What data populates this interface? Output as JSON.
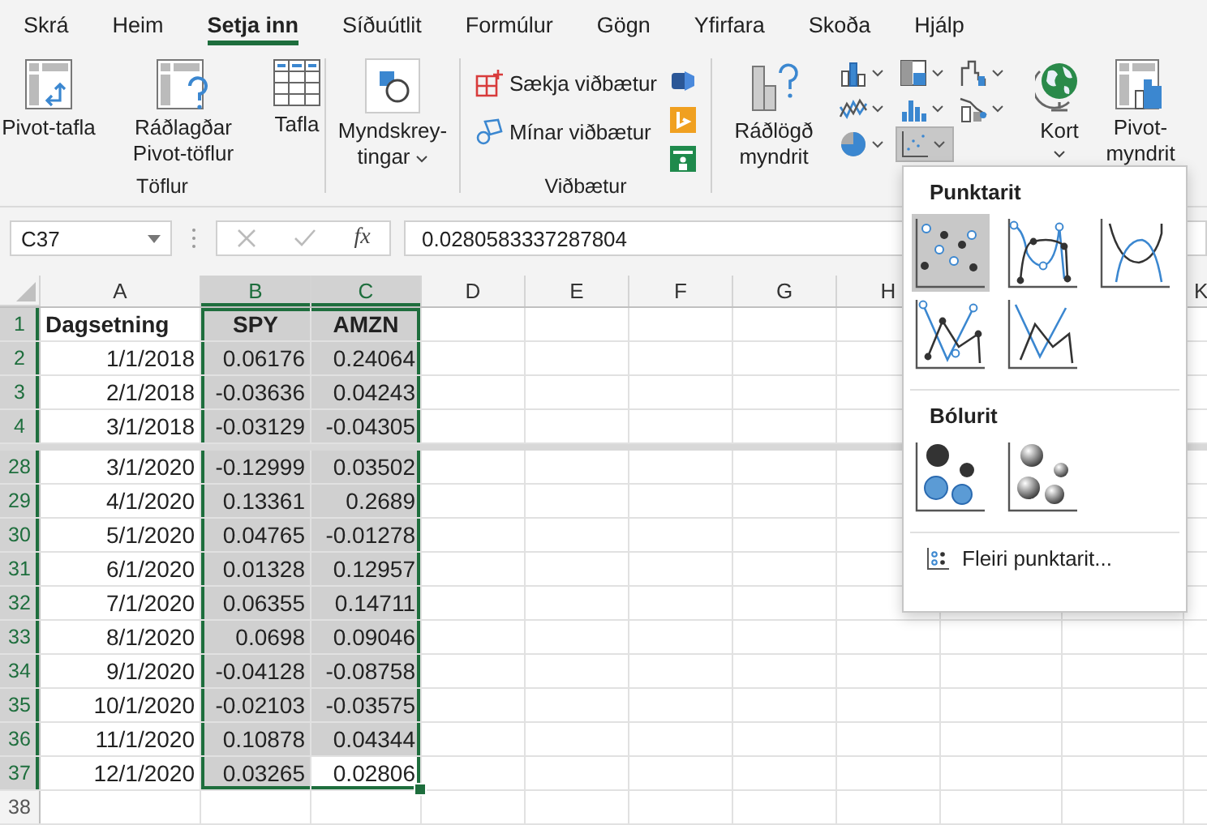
{
  "menu_tabs": [
    {
      "label": "Skrá",
      "selected": false
    },
    {
      "label": "Heim",
      "selected": false
    },
    {
      "label": "Setja inn",
      "selected": true
    },
    {
      "label": "Síðuútlit",
      "selected": false
    },
    {
      "label": "Formúlur",
      "selected": false
    },
    {
      "label": "Gögn",
      "selected": false
    },
    {
      "label": "Yfirfara",
      "selected": false
    },
    {
      "label": "Skoða",
      "selected": false
    },
    {
      "label": "Hjálp",
      "selected": false
    }
  ],
  "ribbon": {
    "tables": {
      "label": "Töflur",
      "buttons": [
        "Pivot-tafla",
        "Ráðlagðar\nPivot-töflur",
        "Tafla"
      ]
    },
    "illustrations": {
      "button": "Myndskrey-\ntingar"
    },
    "addins": {
      "label": "Viðbætur",
      "buttons": [
        "Sækja viðbætur",
        "Mínar viðbætur"
      ]
    },
    "charts": {
      "recommended": "Ráðlögð\nmyndrit",
      "maps": "Kort",
      "pivot_chart": "Pivot-\nmyndrit",
      "type_buttons": [
        {
          "selected": false
        },
        {
          "selected": false
        },
        {
          "selected": false
        },
        {
          "selected": false
        },
        {
          "selected": false
        },
        {
          "selected": false
        },
        {
          "selected": false
        },
        {
          "selected": true
        }
      ]
    }
  },
  "formula_bar": {
    "name_box": "C37",
    "function_label": "fx",
    "formula": "0.0280583337287804"
  },
  "sheet": {
    "columns": [
      {
        "label": "A",
        "selected": false
      },
      {
        "label": "B",
        "selected": true
      },
      {
        "label": "C",
        "selected": true
      },
      {
        "label": "D",
        "selected": false
      },
      {
        "label": "E",
        "selected": false
      },
      {
        "label": "F",
        "selected": false
      },
      {
        "label": "G",
        "selected": false
      },
      {
        "label": "H",
        "selected": false
      },
      {
        "label": "K",
        "selected": false
      }
    ],
    "rows": [
      {
        "number": "1",
        "kind": "header",
        "cells": [
          "Dagsetning",
          "SPY",
          "AMZN"
        ],
        "selected": true,
        "active": false,
        "break_after": false
      },
      {
        "number": "2",
        "kind": "data",
        "cells": [
          "1/1/2018",
          "0.06176",
          "0.24064"
        ],
        "selected": true,
        "active": false,
        "break_after": false
      },
      {
        "number": "3",
        "kind": "data",
        "cells": [
          "2/1/2018",
          "-0.03636",
          "0.04243"
        ],
        "selected": true,
        "active": false,
        "break_after": false
      },
      {
        "number": "4",
        "kind": "data",
        "cells": [
          "3/1/2018",
          "-0.03129",
          "-0.04305"
        ],
        "selected": true,
        "active": false,
        "break_after": true
      },
      {
        "number": "28",
        "kind": "data",
        "cells": [
          "3/1/2020",
          "-0.12999",
          "0.03502"
        ],
        "selected": true,
        "active": false,
        "break_after": false
      },
      {
        "number": "29",
        "kind": "data",
        "cells": [
          "4/1/2020",
          "0.13361",
          "0.2689"
        ],
        "selected": true,
        "active": false,
        "break_after": false
      },
      {
        "number": "30",
        "kind": "data",
        "cells": [
          "5/1/2020",
          "0.04765",
          "-0.01278"
        ],
        "selected": true,
        "active": false,
        "break_after": false
      },
      {
        "number": "31",
        "kind": "data",
        "cells": [
          "6/1/2020",
          "0.01328",
          "0.12957"
        ],
        "selected": true,
        "active": false,
        "break_after": false
      },
      {
        "number": "32",
        "kind": "data",
        "cells": [
          "7/1/2020",
          "0.06355",
          "0.14711"
        ],
        "selected": true,
        "active": false,
        "break_after": false
      },
      {
        "number": "33",
        "kind": "data",
        "cells": [
          "8/1/2020",
          "0.0698",
          "0.09046"
        ],
        "selected": true,
        "active": false,
        "break_after": false
      },
      {
        "number": "34",
        "kind": "data",
        "cells": [
          "9/1/2020",
          "-0.04128",
          "-0.08758"
        ],
        "selected": true,
        "active": false,
        "break_after": false
      },
      {
        "number": "35",
        "kind": "data",
        "cells": [
          "10/1/2020",
          "-0.02103",
          "-0.03575"
        ],
        "selected": true,
        "active": false,
        "break_after": false
      },
      {
        "number": "36",
        "kind": "data",
        "cells": [
          "11/1/2020",
          "0.10878",
          "0.04344"
        ],
        "selected": true,
        "active": false,
        "break_after": false
      },
      {
        "number": "37",
        "kind": "data",
        "cells": [
          "12/1/2020",
          "0.03265",
          "0.02806"
        ],
        "selected": true,
        "active": true,
        "break_after": false
      },
      {
        "number": "38",
        "kind": "empty",
        "selected": false,
        "active": false,
        "break_after": false
      }
    ]
  },
  "dropdown": {
    "title": "Punktarit",
    "scatter_options": [
      {
        "selected": true
      },
      {
        "selected": false
      },
      {
        "selected": false
      },
      {
        "selected": false
      },
      {
        "selected": false
      }
    ],
    "bubble_title": "Bólurit",
    "bubble_options": [
      {
        "selected": false
      },
      {
        "selected": false
      }
    ],
    "more": "Fleiri punktarit..."
  }
}
